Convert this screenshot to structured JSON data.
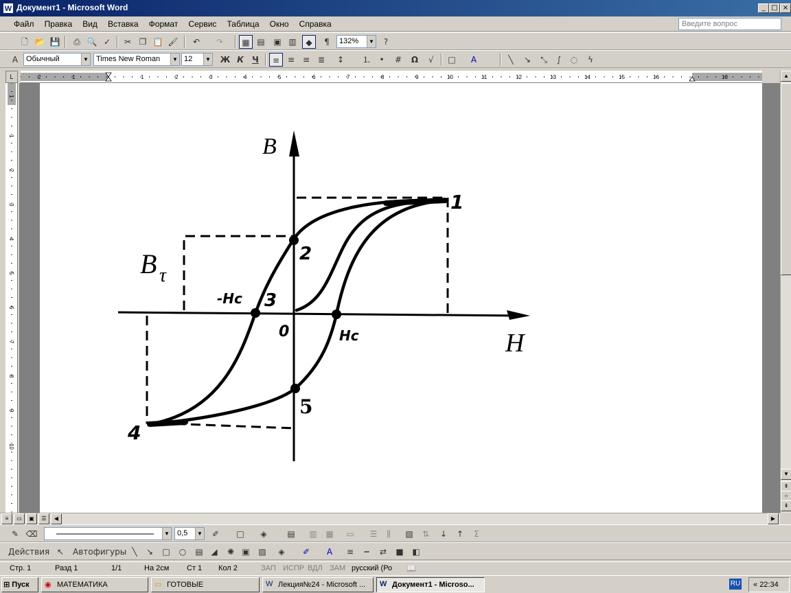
{
  "window": {
    "title": "Документ1 - Microsoft Word",
    "app_icon": "W",
    "controls": {
      "minimize": "_",
      "restore": "□",
      "close": "×"
    }
  },
  "menu": {
    "items": [
      "Файл",
      "Правка",
      "Вид",
      "Вставка",
      "Формат",
      "Сервис",
      "Таблица",
      "Окно",
      "Справка"
    ],
    "ask_placeholder": "Введите вопрос"
  },
  "standard_toolbar": {
    "zoom": "132%",
    "help_icon": "?"
  },
  "formatting_toolbar": {
    "style": "Обычный",
    "font": "Times New Roman",
    "size": "12",
    "bold": "Ж",
    "italic": "К",
    "underline": "Ч",
    "omega": "Ω"
  },
  "ruler": {
    "h_numbers": [
      "2",
      "1",
      "1",
      "2",
      "3",
      "4",
      "5",
      "6",
      "7",
      "8",
      "9",
      "10",
      "11",
      "12",
      "13",
      "14",
      "15",
      "16",
      "18"
    ],
    "v_numbers": [
      "1",
      "1",
      "2",
      "3",
      "4",
      "5",
      "6",
      "7",
      "8",
      "9",
      "10"
    ]
  },
  "figure": {
    "y_axis_label": "B",
    "x_axis_label": "H",
    "origin_label": "0",
    "bt_label": "B",
    "bt_sub": "τ",
    "neg_hc_label": "-Hc",
    "hc_label": "Hc",
    "points": {
      "p1": "1",
      "p2": "2",
      "p3": "3",
      "p4": "4",
      "p5": "5"
    }
  },
  "drawing_toolbar": {
    "line_width": "0,5",
    "actions": "Действия",
    "autoshapes": "Автофигуры",
    "sigma": "Σ"
  },
  "status": {
    "page": "Стр. 1",
    "section": "Разд 1",
    "pages": "1/1",
    "at": "На 2см",
    "line": "Ст 1",
    "col": "Кол 2",
    "rec": "ЗАП",
    "trk": "ИСПР",
    "ext": "ВДЛ",
    "ovr": "ЗАМ",
    "lang": "русский (Ро"
  },
  "taskbar": {
    "start": "Пуск",
    "tasks": [
      "МАТЕМАТИКА",
      "ГОТОВЫЕ",
      "Лекция№24 - Microsoft ...",
      "Документ1 - Microso..."
    ],
    "lang": "RU",
    "clock": "22:34"
  }
}
